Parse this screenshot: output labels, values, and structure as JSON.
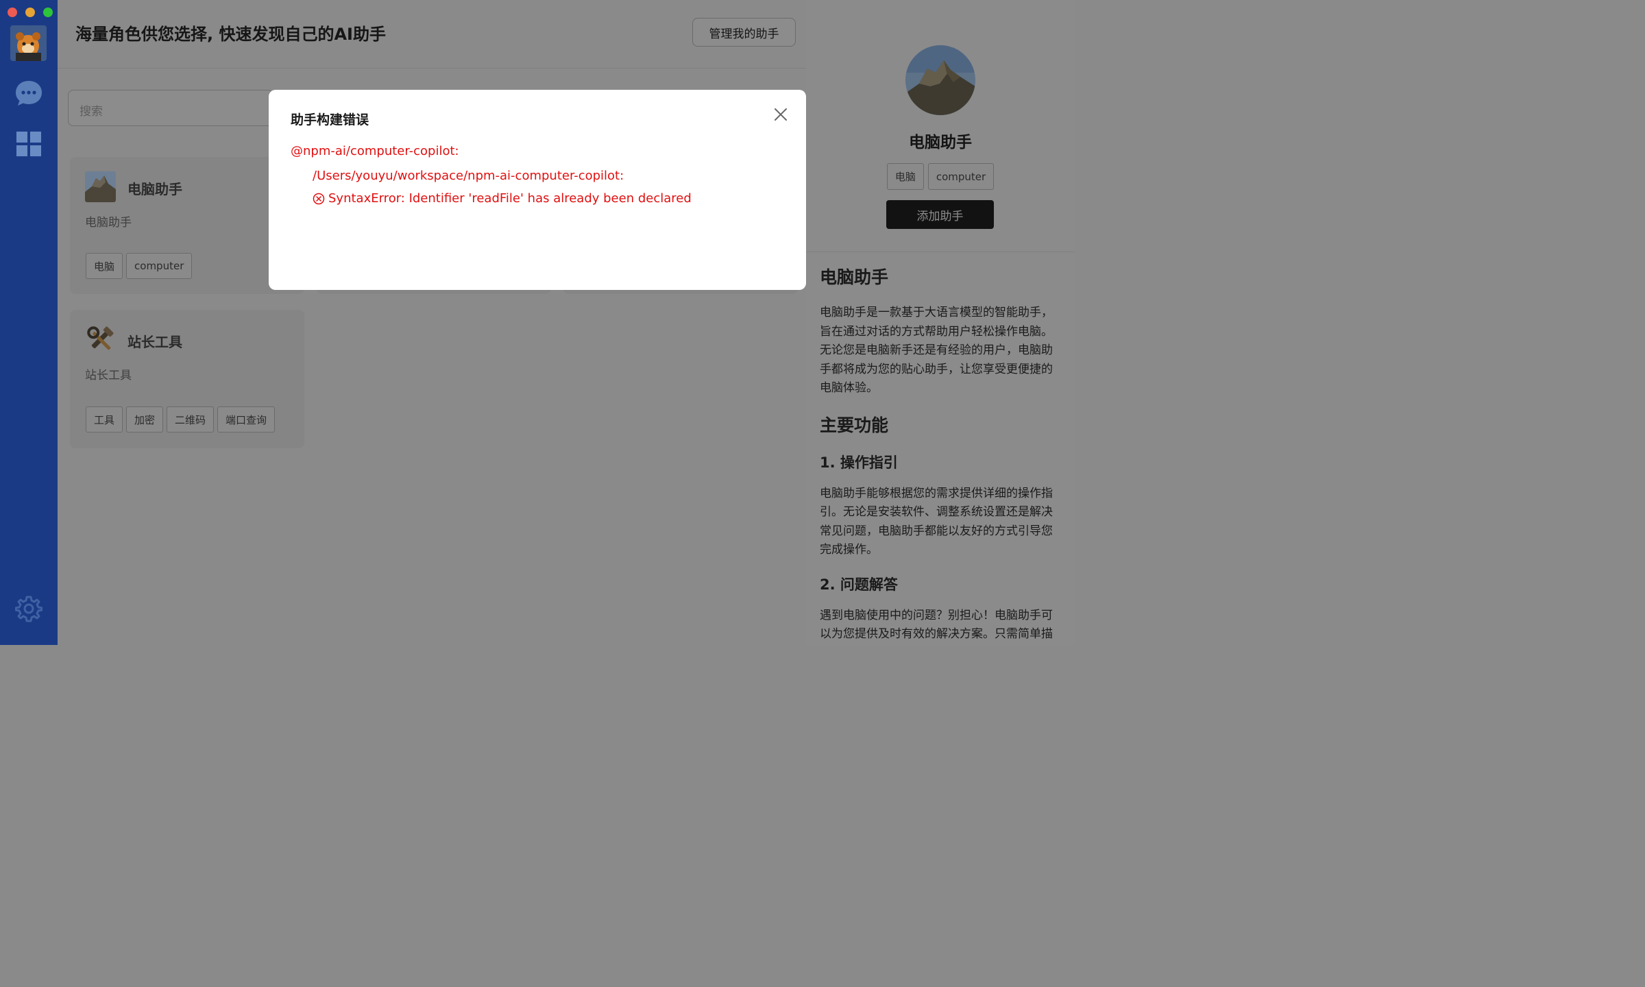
{
  "window": {
    "controls": [
      "close",
      "minimize",
      "zoom"
    ]
  },
  "sidebar": {
    "items": [
      {
        "icon": "chat-bubble-icon"
      },
      {
        "icon": "grid-icon"
      }
    ],
    "bottom_icon": "gear-icon"
  },
  "header": {
    "title": "海量角色供您选择, 快速发现自己的AI助手",
    "manage_button": "管理我的助手"
  },
  "search": {
    "placeholder": "搜索"
  },
  "cards": [
    {
      "title": "电脑助手",
      "description": "电脑助手",
      "tags": [
        "电脑",
        "computer"
      ]
    },
    {
      "title": "站长工具",
      "description": "站长工具",
      "tags": [
        "工具",
        "加密",
        "二维码",
        "端口查询"
      ]
    }
  ],
  "detail": {
    "name": "电脑助手",
    "tags": [
      "电脑",
      "computer"
    ],
    "add_button": "添加助手",
    "doc_title": "电脑助手",
    "intro": "电脑助手是一款基于大语言模型的智能助手，旨在通过对话的方式帮助用户轻松操作电脑。无论您是电脑新手还是有经验的用户，电脑助手都将成为您的贴心助手，让您享受更便捷的电脑体验。",
    "features_heading": "主要功能",
    "feature1_heading": "1. 操作指引",
    "feature1_text": "电脑助手能够根据您的需求提供详细的操作指引。无论是安装软件、调整系统设置还是解决常见问题，电脑助手都能以友好的方式引导您完成操作。",
    "feature2_heading": "2. 问题解答",
    "feature2_text": "遇到电脑使用中的问题？别担心！电脑助手可以为您提供及时有效的解决方案。只需简单描述问题，电脑助手就能为您找到解决方案。"
  },
  "modal": {
    "title": "助手构建错误",
    "package": "@npm-ai/computer-copilot:",
    "path": "/Users/youyu/workspace/npm-ai-computer-copilot:",
    "error": "SyntaxError: Identifier 'readFile' has already been declared",
    "error_color": "#e01010"
  }
}
